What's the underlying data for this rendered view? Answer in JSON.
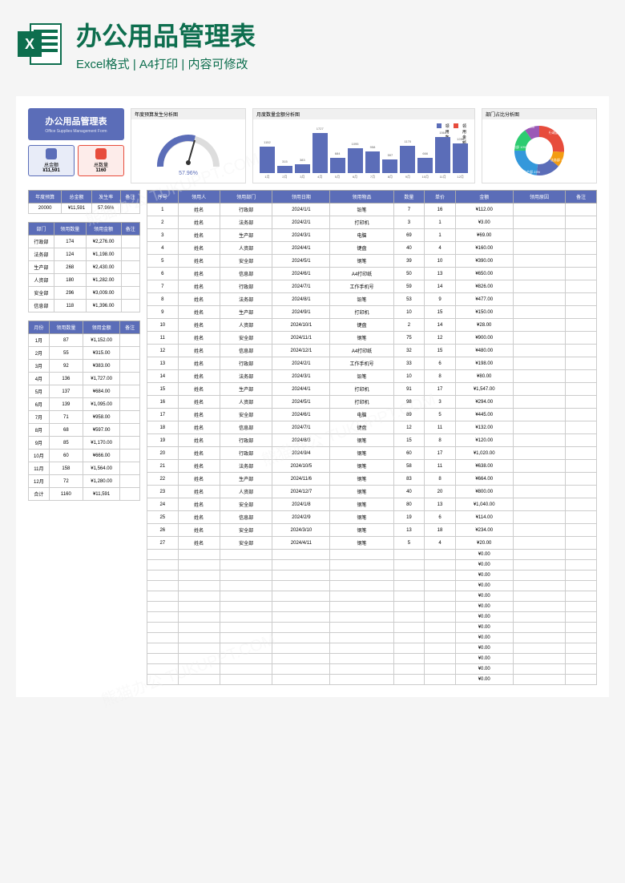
{
  "header": {
    "title": "办公用品管理表",
    "subtitle": "Excel格式 | A4打印 | 内容可修改"
  },
  "titleCard": {
    "main": "办公用品管理表",
    "sub": "Office Supplies Management Form"
  },
  "stats": {
    "totalAmountLabel": "总金额",
    "totalAmount": "¥11,591",
    "totalQtyLabel": "总数量",
    "totalQty": "1160"
  },
  "charts": {
    "gaugeTitle": "年度预算发生分析图",
    "gaugeValue": "57.96%",
    "barTitle": "月度数量金额分析图",
    "barLegend1": "领用数量",
    "barLegend2": "领用金额",
    "pieTitle": "部门占比分析图"
  },
  "budgetTable": {
    "headers": [
      "年度预算",
      "总金额",
      "发生率",
      "备注"
    ],
    "rows": [
      [
        "20000",
        "¥11,591",
        "57.96%",
        ""
      ]
    ]
  },
  "deptTable": {
    "headers": [
      "部门",
      "领用数量",
      "领用金额",
      "备注"
    ],
    "rows": [
      [
        "行政部",
        "174",
        "¥2,276.00",
        ""
      ],
      [
        "法务部",
        "124",
        "¥1,198.00",
        ""
      ],
      [
        "生产部",
        "268",
        "¥2,430.00",
        ""
      ],
      [
        "人资部",
        "180",
        "¥1,282.00",
        ""
      ],
      [
        "安全部",
        "296",
        "¥3,009.00",
        ""
      ],
      [
        "信息部",
        "118",
        "¥1,396.00",
        ""
      ]
    ]
  },
  "monthTable": {
    "headers": [
      "月份",
      "领用数量",
      "领用金额",
      "备注"
    ],
    "rows": [
      [
        "1月",
        "87",
        "¥1,152.00",
        ""
      ],
      [
        "2月",
        "55",
        "¥315.00",
        ""
      ],
      [
        "3月",
        "92",
        "¥383.00",
        ""
      ],
      [
        "4月",
        "136",
        "¥1,727.00",
        ""
      ],
      [
        "5月",
        "137",
        "¥684.00",
        ""
      ],
      [
        "6月",
        "139",
        "¥1,095.00",
        ""
      ],
      [
        "7月",
        "71",
        "¥958.00",
        ""
      ],
      [
        "8月",
        "68",
        "¥597.00",
        ""
      ],
      [
        "9月",
        "85",
        "¥1,170.00",
        ""
      ],
      [
        "10月",
        "60",
        "¥666.00",
        ""
      ],
      [
        "11月",
        "158",
        "¥1,564.00",
        ""
      ],
      [
        "12月",
        "72",
        "¥1,280.00",
        ""
      ],
      [
        "合计",
        "1160",
        "¥11,591",
        ""
      ]
    ]
  },
  "mainTable": {
    "headers": [
      "序号",
      "领用人",
      "领用部门",
      "领用日期",
      "领用物品",
      "数量",
      "单价",
      "金额",
      "领用原因",
      "备注"
    ],
    "rows": [
      [
        "1",
        "姓名",
        "行政部",
        "2024/1/1",
        "铅笔",
        "7",
        "16",
        "¥112.00",
        "",
        ""
      ],
      [
        "2",
        "姓名",
        "法务部",
        "2024/2/1",
        "打印机",
        "3",
        "1",
        "¥3.00",
        "",
        ""
      ],
      [
        "3",
        "姓名",
        "生产部",
        "2024/3/1",
        "电脑",
        "69",
        "1",
        "¥69.00",
        "",
        ""
      ],
      [
        "4",
        "姓名",
        "人资部",
        "2024/4/1",
        "键盘",
        "40",
        "4",
        "¥160.00",
        "",
        ""
      ],
      [
        "5",
        "姓名",
        "安全部",
        "2024/5/1",
        "钢笔",
        "39",
        "10",
        "¥390.00",
        "",
        ""
      ],
      [
        "6",
        "姓名",
        "信息部",
        "2024/6/1",
        "A4打印纸",
        "50",
        "13",
        "¥650.00",
        "",
        ""
      ],
      [
        "7",
        "姓名",
        "行政部",
        "2024/7/1",
        "工作手机号",
        "59",
        "14",
        "¥826.00",
        "",
        ""
      ],
      [
        "8",
        "姓名",
        "法务部",
        "2024/8/1",
        "铅笔",
        "53",
        "9",
        "¥477.00",
        "",
        ""
      ],
      [
        "9",
        "姓名",
        "生产部",
        "2024/9/1",
        "打印机",
        "10",
        "15",
        "¥150.00",
        "",
        ""
      ],
      [
        "10",
        "姓名",
        "人资部",
        "2024/10/1",
        "键盘",
        "2",
        "14",
        "¥28.00",
        "",
        ""
      ],
      [
        "11",
        "姓名",
        "安全部",
        "2024/11/1",
        "钢笔",
        "75",
        "12",
        "¥900.00",
        "",
        ""
      ],
      [
        "12",
        "姓名",
        "信息部",
        "2024/12/1",
        "A4打印纸",
        "32",
        "15",
        "¥480.00",
        "",
        ""
      ],
      [
        "13",
        "姓名",
        "行政部",
        "2024/2/1",
        "工作手机号",
        "33",
        "6",
        "¥198.00",
        "",
        ""
      ],
      [
        "14",
        "姓名",
        "法务部",
        "2024/3/1",
        "铅笔",
        "10",
        "8",
        "¥80.00",
        "",
        ""
      ],
      [
        "15",
        "姓名",
        "生产部",
        "2024/4/1",
        "打印机",
        "91",
        "17",
        "¥1,547.00",
        "",
        ""
      ],
      [
        "16",
        "姓名",
        "人资部",
        "2024/5/1",
        "打印机",
        "98",
        "3",
        "¥294.00",
        "",
        ""
      ],
      [
        "17",
        "姓名",
        "安全部",
        "2024/6/1",
        "电脑",
        "89",
        "5",
        "¥445.00",
        "",
        ""
      ],
      [
        "18",
        "姓名",
        "信息部",
        "2024/7/1",
        "键盘",
        "12",
        "11",
        "¥132.00",
        "",
        ""
      ],
      [
        "19",
        "姓名",
        "行政部",
        "2024/8/3",
        "钢笔",
        "15",
        "8",
        "¥120.00",
        "",
        ""
      ],
      [
        "20",
        "姓名",
        "行政部",
        "2024/9/4",
        "钢笔",
        "60",
        "17",
        "¥1,020.00",
        "",
        ""
      ],
      [
        "21",
        "姓名",
        "法务部",
        "2024/10/5",
        "钢笔",
        "58",
        "11",
        "¥638.00",
        "",
        ""
      ],
      [
        "22",
        "姓名",
        "生产部",
        "2024/11/6",
        "钢笔",
        "83",
        "8",
        "¥664.00",
        "",
        ""
      ],
      [
        "23",
        "姓名",
        "人资部",
        "2024/12/7",
        "钢笔",
        "40",
        "20",
        "¥800.00",
        "",
        ""
      ],
      [
        "24",
        "姓名",
        "安全部",
        "2024/1/8",
        "钢笔",
        "80",
        "13",
        "¥1,040.00",
        "",
        ""
      ],
      [
        "25",
        "姓名",
        "信息部",
        "2024/2/9",
        "钢笔",
        "19",
        "6",
        "¥114.00",
        "",
        ""
      ],
      [
        "26",
        "姓名",
        "安全部",
        "2024/3/10",
        "钢笔",
        "13",
        "18",
        "¥234.00",
        "",
        ""
      ],
      [
        "27",
        "姓名",
        "安全部",
        "2024/4/11",
        "钢笔",
        "5",
        "4",
        "¥20.00",
        "",
        ""
      ],
      [
        "",
        "",
        "",
        "",
        "",
        "",
        "",
        "¥0.00",
        "",
        ""
      ],
      [
        "",
        "",
        "",
        "",
        "",
        "",
        "",
        "¥0.00",
        "",
        ""
      ],
      [
        "",
        "",
        "",
        "",
        "",
        "",
        "",
        "¥0.00",
        "",
        ""
      ],
      [
        "",
        "",
        "",
        "",
        "",
        "",
        "",
        "¥0.00",
        "",
        ""
      ],
      [
        "",
        "",
        "",
        "",
        "",
        "",
        "",
        "¥0.00",
        "",
        ""
      ],
      [
        "",
        "",
        "",
        "",
        "",
        "",
        "",
        "¥0.00",
        "",
        ""
      ],
      [
        "",
        "",
        "",
        "",
        "",
        "",
        "",
        "¥0.00",
        "",
        ""
      ],
      [
        "",
        "",
        "",
        "",
        "",
        "",
        "",
        "¥0.00",
        "",
        ""
      ],
      [
        "",
        "",
        "",
        "",
        "",
        "",
        "",
        "¥0.00",
        "",
        ""
      ],
      [
        "",
        "",
        "",
        "",
        "",
        "",
        "",
        "¥0.00",
        "",
        ""
      ],
      [
        "",
        "",
        "",
        "",
        "",
        "",
        "",
        "¥0.00",
        "",
        ""
      ],
      [
        "",
        "",
        "",
        "",
        "",
        "",
        "",
        "¥0.00",
        "",
        ""
      ],
      [
        "",
        "",
        "",
        "",
        "",
        "",
        "",
        "¥0.00",
        "",
        ""
      ]
    ]
  },
  "chart_data": [
    {
      "type": "bar",
      "title": "月度数量金额分析图",
      "categories": [
        "1月",
        "2月",
        "3月",
        "4月",
        "5月",
        "6月",
        "7月",
        "8月",
        "9月",
        "10月",
        "11月",
        "12月"
      ],
      "series": [
        {
          "name": "领用金额",
          "values": [
            1152,
            315,
            383,
            1727,
            684,
            1095,
            958,
            597,
            1170,
            666,
            1564,
            1280
          ]
        },
        {
          "name": "领用数量",
          "values": [
            87,
            55,
            92,
            136,
            137,
            139,
            71,
            68,
            85,
            60,
            158,
            72
          ]
        }
      ],
      "ylim": [
        0,
        1800
      ]
    },
    {
      "type": "pie",
      "title": "部门占比分析图",
      "categories": [
        "行政部",
        "法务部",
        "生产部",
        "人资部",
        "安全部",
        "信息部"
      ],
      "values": [
        15,
        10,
        23,
        16,
        26,
        10
      ],
      "labels_suffix": "%"
    }
  ],
  "pieLabels": {
    "行政部": "行政部 15%",
    "法务部": "法务部 10%",
    "生产部": "生产部 23%",
    "人资部": "人资部 16%",
    "安全部": "安全部 26%",
    "信息部": "信息部 10%"
  },
  "watermark": "熊猫办公 TUKUPPT.COM"
}
